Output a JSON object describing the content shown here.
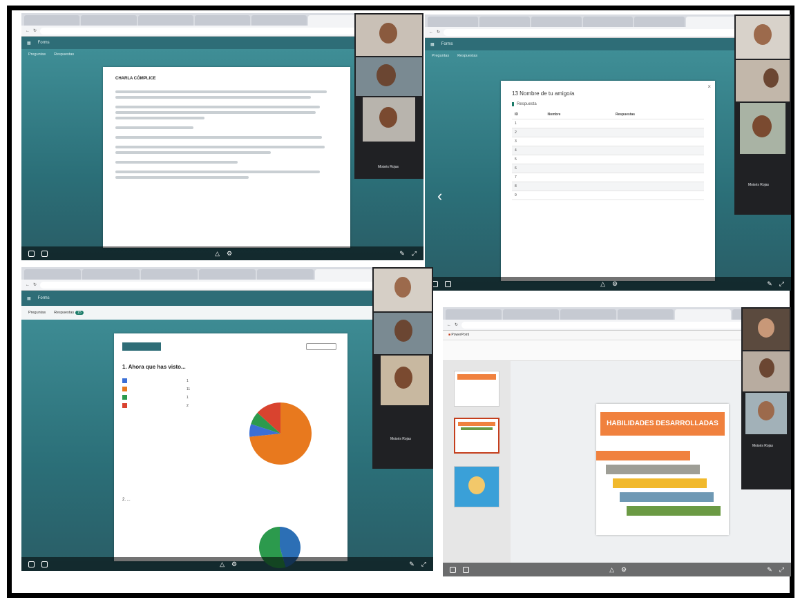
{
  "colors": {
    "teal": "#2e6d77",
    "forms_green": "#1b7b68",
    "orange": "#e8791e",
    "banner_orange": "#f0813e"
  },
  "panels": {
    "p1": {
      "app": "Forms",
      "doc_heading": "CHARLA CÓMPLICE",
      "tabs": [
        "Preguntas",
        "Respuestas"
      ],
      "badge": "",
      "participant_names": [
        "Moisés Rojas"
      ],
      "time_left": "",
      "time_right": ""
    },
    "p2": {
      "app": "Forms",
      "tabs": [
        "Preguntas",
        "Respuestas"
      ],
      "modal_title": "13 Nombre de tu amigo/a",
      "modal_sub": "Respuesta",
      "table_headers": [
        "ID",
        "Nombre",
        "Respuestas"
      ],
      "table_rows": [
        {
          "id": "1",
          "name": "",
          "resp": ""
        },
        {
          "id": "2",
          "name": "",
          "resp": ""
        },
        {
          "id": "3",
          "name": "",
          "resp": ""
        },
        {
          "id": "4",
          "name": "",
          "resp": ""
        },
        {
          "id": "5",
          "name": "",
          "resp": ""
        },
        {
          "id": "6",
          "name": "",
          "resp": ""
        },
        {
          "id": "7",
          "name": "",
          "resp": ""
        },
        {
          "id": "8",
          "name": "",
          "resp": ""
        },
        {
          "id": "9",
          "name": "",
          "resp": ""
        }
      ],
      "participant_names": [
        "Moisés Rojas"
      ]
    },
    "p3": {
      "app": "Forms",
      "tabs": [
        "Preguntas",
        "Respuestas"
      ],
      "badge": "15",
      "header_title": "",
      "chip": "",
      "question": "1. Ahora que has visto...",
      "question_sub": "",
      "legend": [
        {
          "label": "",
          "count": "1",
          "color": "#3b6fd6"
        },
        {
          "label": "",
          "count": "11",
          "color": "#e8791e"
        },
        {
          "label": "",
          "count": "1",
          "color": "#2c9a4d"
        },
        {
          "label": "",
          "count": "2",
          "color": "#d9432f"
        }
      ],
      "pie": [
        {
          "color": "#e8791e",
          "value": 11
        },
        {
          "color": "#3b6fd6",
          "value": 1
        },
        {
          "color": "#2c9a4d",
          "value": 1
        },
        {
          "color": "#d9432f",
          "value": 2
        }
      ],
      "q2": "2. ...",
      "participant_names": [
        "Moisés Rojas"
      ]
    },
    "p4": {
      "app": "PowerPoint",
      "slide_title": "HABILIDADES DESARROLLADAS",
      "slide_sub": "",
      "steps": [
        {
          "label": "",
          "color": "#f0813e"
        },
        {
          "label": "",
          "color": "#9e9e96"
        },
        {
          "label": "",
          "color": "#f1b92c"
        },
        {
          "label": "",
          "color": "#6f99b4"
        },
        {
          "label": "",
          "color": "#6b9a44"
        }
      ],
      "participant_names": [
        "Moisés Rojas",
        ""
      ]
    }
  }
}
